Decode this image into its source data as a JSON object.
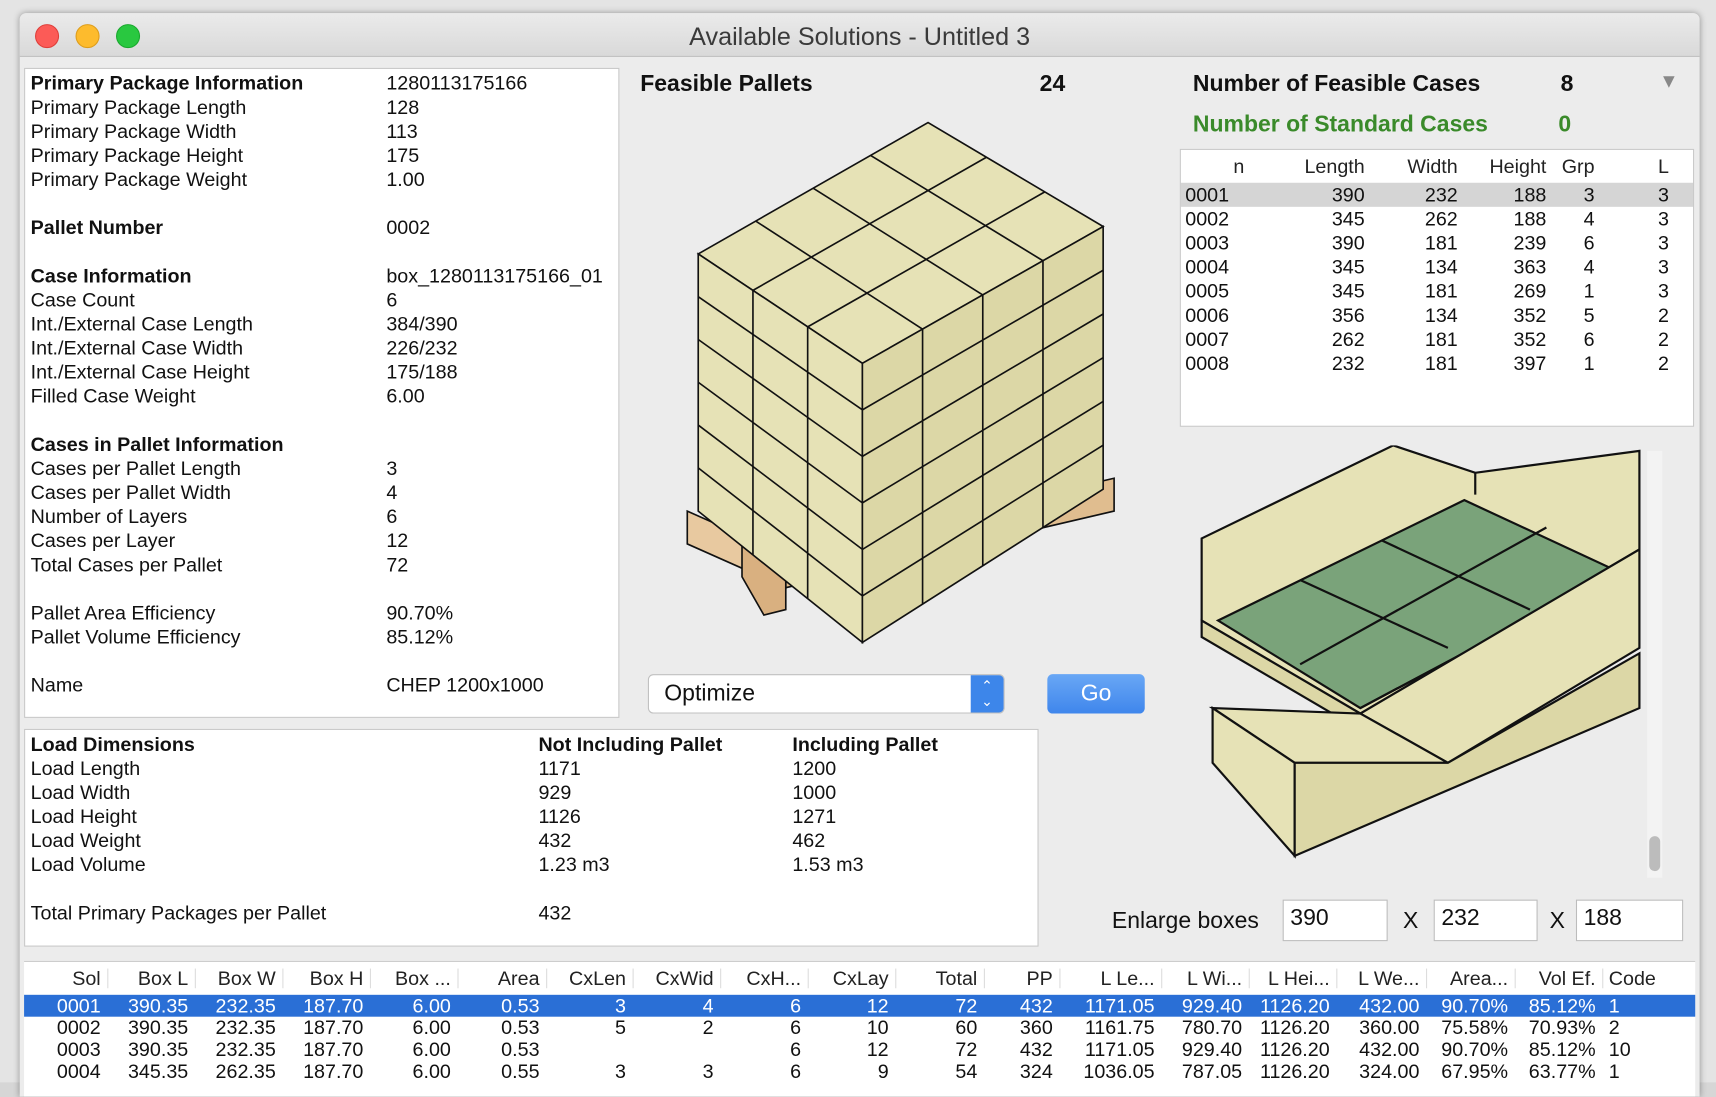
{
  "window": {
    "title": "Available Solutions - Untitled 3"
  },
  "info": {
    "rows": [
      {
        "label": "Primary Package Information",
        "value": "1280113175166",
        "bold": true
      },
      {
        "label": "Primary Package Length",
        "value": "128"
      },
      {
        "label": "Primary Package Width",
        "value": "113"
      },
      {
        "label": "Primary Package Height",
        "value": "175"
      },
      {
        "label": "Primary Package Weight",
        "value": "1.00"
      },
      {
        "label": "",
        "value": ""
      },
      {
        "label": "Pallet Number",
        "value": "0002",
        "bold": true
      },
      {
        "label": "",
        "value": ""
      },
      {
        "label": "Case Information",
        "value": "box_1280113175166_01",
        "bold": true
      },
      {
        "label": "Case Count",
        "value": "6"
      },
      {
        "label": "Int./External Case Length",
        "value": "384/390"
      },
      {
        "label": "Int./External Case Width",
        "value": "226/232"
      },
      {
        "label": "Int./External Case Height",
        "value": "175/188"
      },
      {
        "label": "Filled Case Weight",
        "value": "6.00"
      },
      {
        "label": "",
        "value": ""
      },
      {
        "label": "Cases in Pallet Information",
        "value": "",
        "bold": true
      },
      {
        "label": "Cases per Pallet Length",
        "value": "3"
      },
      {
        "label": "Cases per Pallet Width",
        "value": "4"
      },
      {
        "label": "Number of Layers",
        "value": "6"
      },
      {
        "label": "Cases per Layer",
        "value": "12"
      },
      {
        "label": "Total Cases per Pallet",
        "value": "72"
      },
      {
        "label": "",
        "value": ""
      },
      {
        "label": "Pallet Area Efficiency",
        "value": "90.70%"
      },
      {
        "label": "Pallet Volume Efficiency",
        "value": "85.12%"
      },
      {
        "label": "",
        "value": ""
      },
      {
        "label": "Name",
        "value": "CHEP 1200x1000"
      }
    ]
  },
  "feasible_pallets": {
    "label": "Feasible Pallets",
    "value": "24"
  },
  "optimize": {
    "selected": "Optimize",
    "go_label": "Go"
  },
  "load": {
    "headers": [
      "Load Dimensions",
      "Not Including Pallet",
      "Including Pallet"
    ],
    "rows": [
      [
        "Load Length",
        "1171",
        "1200"
      ],
      [
        "Load Width",
        "929",
        "1000"
      ],
      [
        "Load Height",
        "1126",
        "1271"
      ],
      [
        "Load Weight",
        "432",
        "462"
      ],
      [
        "Load Volume",
        "1.23 m3",
        "1.53 m3"
      ]
    ],
    "total_label": "Total Primary Packages per Pallet",
    "total_value": "432"
  },
  "cases": {
    "feasible_label": "Number of Feasible Cases",
    "feasible_value": "8",
    "standard_label": "Number of Standard Cases",
    "standard_value": "0",
    "standard_color": "#3a8a2a",
    "headers": [
      "n",
      "Length",
      "Width",
      "Height",
      "Grp",
      "L"
    ],
    "rows": [
      [
        "0001",
        "390",
        "232",
        "188",
        "3",
        "3"
      ],
      [
        "0002",
        "345",
        "262",
        "188",
        "4",
        "3"
      ],
      [
        "0003",
        "390",
        "181",
        "239",
        "6",
        "3"
      ],
      [
        "0004",
        "345",
        "134",
        "363",
        "4",
        "3"
      ],
      [
        "0005",
        "345",
        "181",
        "269",
        "1",
        "3"
      ],
      [
        "0006",
        "356",
        "134",
        "352",
        "5",
        "2"
      ],
      [
        "0007",
        "262",
        "181",
        "352",
        "6",
        "2"
      ],
      [
        "0008",
        "232",
        "181",
        "397",
        "1",
        "2"
      ]
    ],
    "selected_row": 0
  },
  "enlarge": {
    "label": "Enlarge boxes",
    "x": "X",
    "l": "390",
    "w": "232",
    "h": "188"
  },
  "solutions": {
    "headers": [
      "Sol",
      "Box L",
      "Box W",
      "Box H",
      "Box ...",
      "Area",
      "CxLen",
      "CxWid",
      "CxH...",
      "CxLay",
      "Total",
      "PP",
      "L Le...",
      "L Wi...",
      "L Hei...",
      "L We...",
      "Area...",
      "Vol Ef.",
      "Code"
    ],
    "rows": [
      [
        "0001",
        "390.35",
        "232.35",
        "187.70",
        "6.00",
        "0.53",
        "3",
        "4",
        "6",
        "12",
        "72",
        "432",
        "1171.05",
        "929.40",
        "1126.20",
        "432.00",
        "90.70%",
        "85.12%",
        "1"
      ],
      [
        "0002",
        "390.35",
        "232.35",
        "187.70",
        "6.00",
        "0.53",
        "5",
        "2",
        "6",
        "10",
        "60",
        "360",
        "1161.75",
        "780.70",
        "1126.20",
        "360.00",
        "75.58%",
        "70.93%",
        "2"
      ],
      [
        "0003",
        "390.35",
        "232.35",
        "187.70",
        "6.00",
        "0.53",
        "",
        "",
        "6",
        "12",
        "72",
        "432",
        "1171.05",
        "929.40",
        "1126.20",
        "432.00",
        "90.70%",
        "85.12%",
        "10"
      ],
      [
        "0004",
        "345.35",
        "262.35",
        "187.70",
        "6.00",
        "0.55",
        "3",
        "3",
        "6",
        "9",
        "54",
        "324",
        "1036.05",
        "787.05",
        "1126.20",
        "324.00",
        "67.95%",
        "63.77%",
        "1"
      ]
    ],
    "selected_row": 0,
    "selection_color": "#2a6fd6"
  },
  "colors": {
    "box_fill": "#e6e2b6",
    "case_inner_green": "#7aa37a",
    "pallet_wood": "#e8c9a0"
  }
}
